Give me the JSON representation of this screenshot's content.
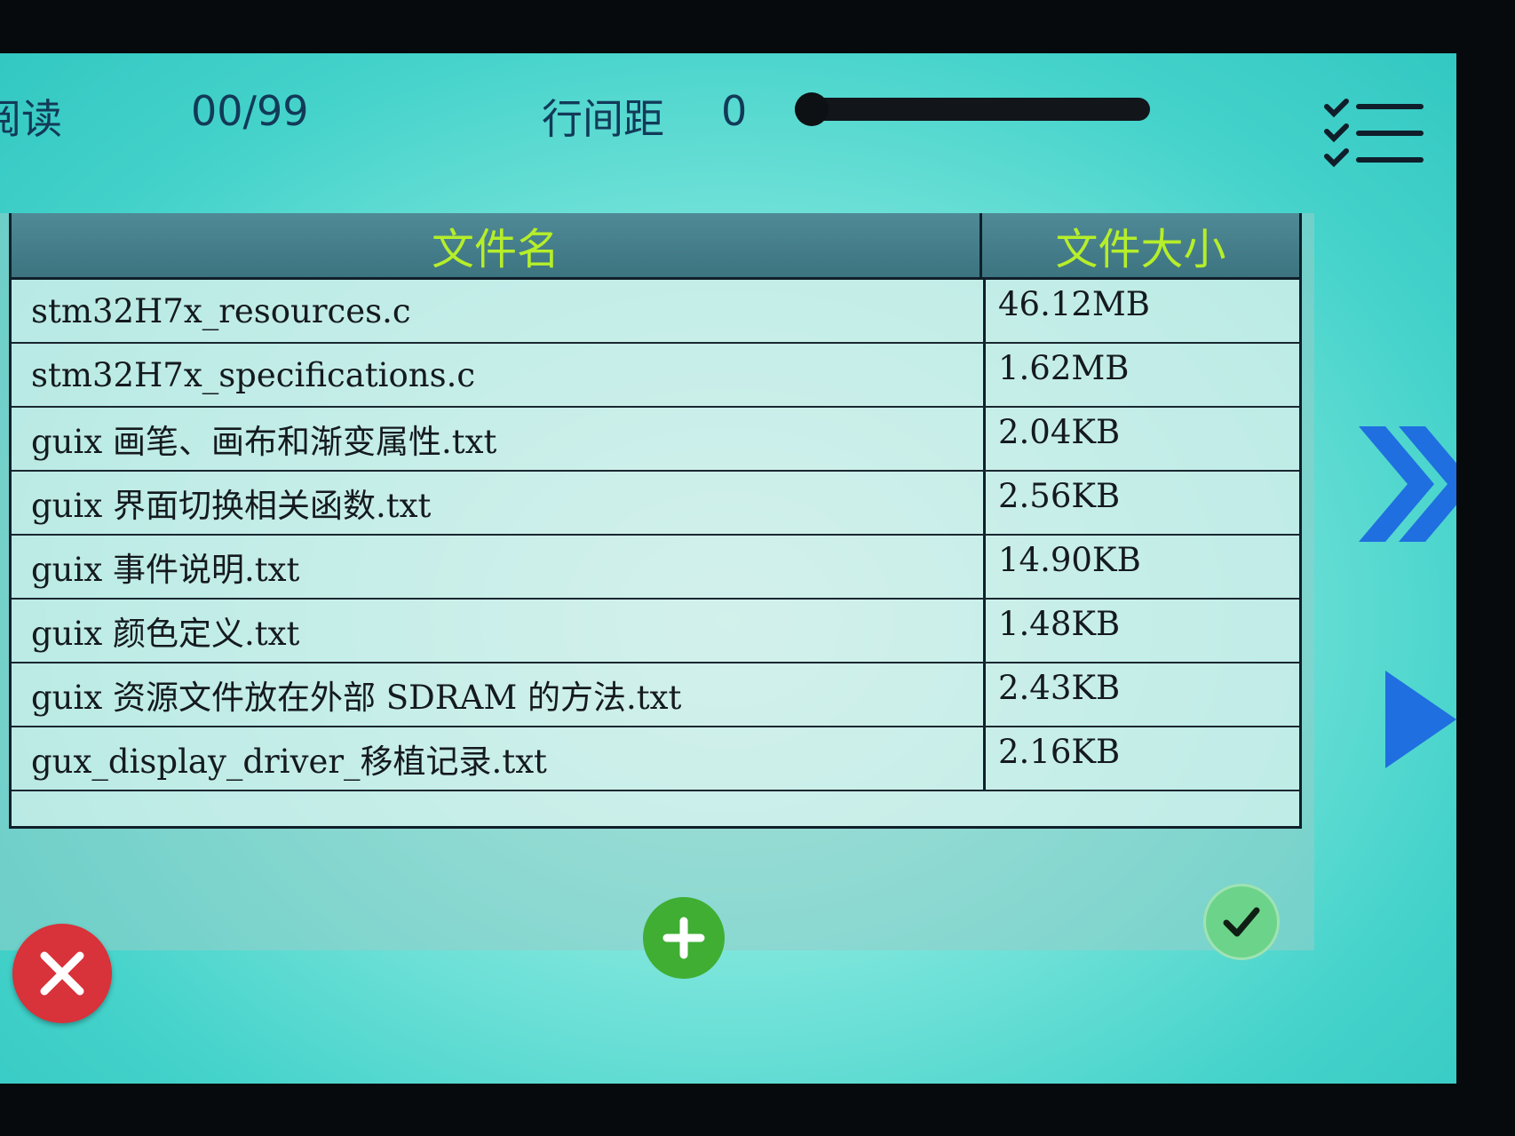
{
  "header": {
    "mode_label": "阅读",
    "page_counter": "00/99",
    "line_spacing_label": "行间距",
    "line_spacing_value": "0"
  },
  "table": {
    "columns": [
      "文件名",
      "文件大小"
    ],
    "rows": [
      {
        "name": "stm32H7x_resources.c",
        "size": "46.12MB"
      },
      {
        "name": "stm32H7x_specifications.c",
        "size": "1.62MB"
      },
      {
        "name": "guix 画笔、画布和渐变属性.txt",
        "size": "2.04KB"
      },
      {
        "name": "guix 界面切换相关函数.txt",
        "size": "2.56KB"
      },
      {
        "name": "guix 事件说明.txt",
        "size": "14.90KB"
      },
      {
        "name": "guix 颜色定义.txt",
        "size": "1.48KB"
      },
      {
        "name": "guix 资源文件放在外部 SDRAM 的方法.txt",
        "size": "2.43KB"
      },
      {
        "name": "gux_display_driver_移植记录.txt",
        "size": "2.16KB"
      }
    ]
  },
  "icons": {
    "menu": "checklist-icon",
    "next": "double-chevron-right-icon",
    "last": "skip-to-end-icon",
    "close": "close-icon",
    "add": "plus-icon",
    "ok": "check-icon"
  },
  "colors": {
    "header_text": "#b6ee2a",
    "nav_blue": "#1f6fe0",
    "close_red": "#d8323a",
    "add_green": "#3fae33",
    "ok_green": "#6cd48a"
  }
}
